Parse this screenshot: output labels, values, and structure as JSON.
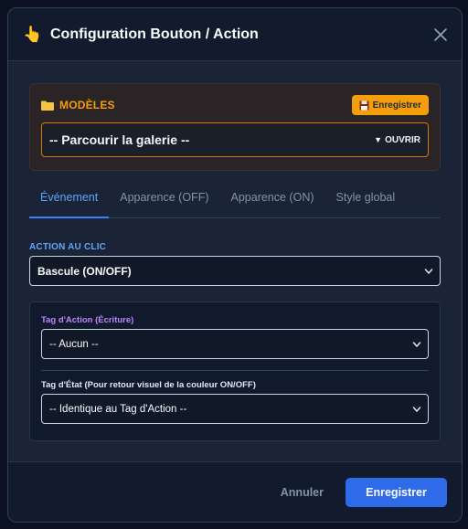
{
  "header": {
    "icon": "pointing-hand-icon",
    "title": "Configuration Bouton / Action",
    "close_icon": "close-icon"
  },
  "models": {
    "title": "MODÈLES",
    "save_label": "Enregistrer",
    "gallery_placeholder": "-- Parcourir la galerie --",
    "open_label": "OUVRIR",
    "accent_color": "#f59e0b"
  },
  "tabs": [
    {
      "label": "Événement",
      "active": true
    },
    {
      "label": "Apparence (OFF)",
      "active": false
    },
    {
      "label": "Apparence (ON)",
      "active": false
    },
    {
      "label": "Style global",
      "active": false
    }
  ],
  "action": {
    "label": "ACTION AU CLIC",
    "selected": "Bascule (ON/OFF)"
  },
  "tags": {
    "action_tag_label": "Tag d'Action (Écriture)",
    "action_tag_value": "-- Aucun --",
    "state_tag_label": "Tag d'État (Pour retour visuel de la couleur ON/OFF)",
    "state_tag_value": "-- Identique au Tag d'Action --"
  },
  "footer": {
    "cancel_label": "Annuler",
    "save_label": "Enregistrer",
    "primary_color": "#2f6ae9"
  }
}
